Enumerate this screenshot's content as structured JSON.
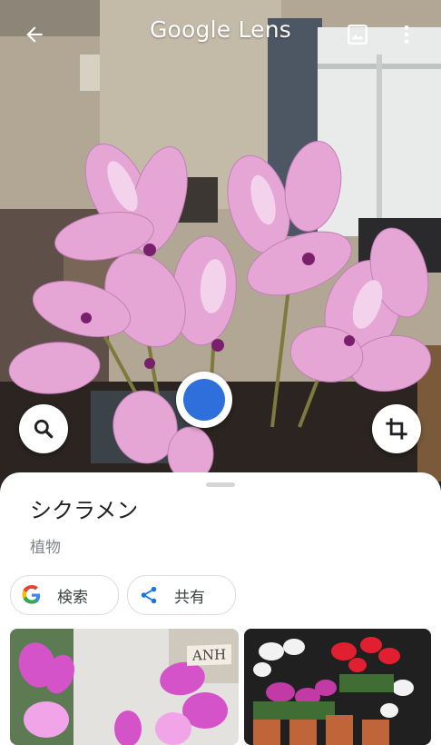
{
  "header": {
    "title": "Google Lens",
    "icons": [
      "arrow-back-icon",
      "image-gallery-icon",
      "more-vert-icon"
    ],
    "text_color": "#ffffff"
  },
  "camera": {
    "subject": "pink cyclamen flowers",
    "shutter_color": "#2f6fdb",
    "buttons": [
      "search-icon",
      "crop-icon"
    ]
  },
  "result": {
    "title": "シクラメン",
    "subtitle": "植物"
  },
  "actions": [
    {
      "label": "検索",
      "icon": "google-g-icon"
    },
    {
      "label": "共有",
      "icon": "share-icon"
    }
  ],
  "thumbnails": [
    {
      "caption_tag": "ANH",
      "description": "pink cyclamen close-up"
    },
    {
      "description": "red, white and magenta cyclamen pots"
    }
  ]
}
